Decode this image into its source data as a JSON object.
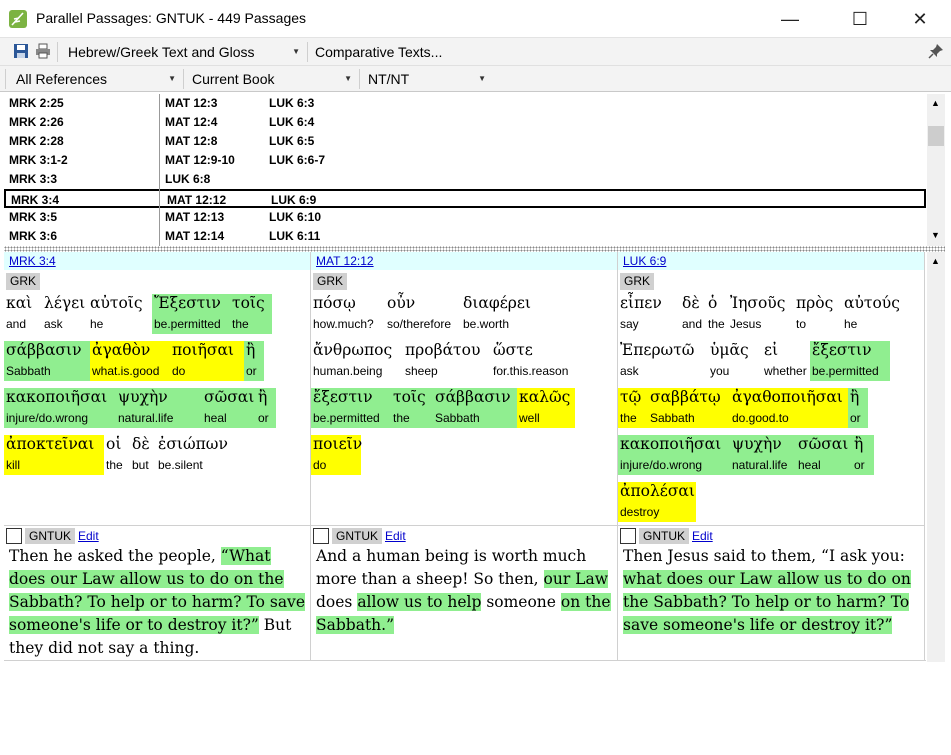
{
  "window": {
    "title": "Parallel Passages: GNTUK - 449 Passages",
    "minimize": "—",
    "maximize": "☐",
    "close": "✕"
  },
  "toolbar": {
    "text_combo": "Hebrew/Greek Text and Gloss",
    "comparative": "Comparative Texts...",
    "pin_icon": "pin-icon"
  },
  "filters": {
    "references": "All References",
    "book": "Current Book",
    "testament": "NT/NT"
  },
  "references": [
    {
      "c1": "MRK 2:25",
      "c2": "MAT 12:3",
      "c3": "LUK 6:3"
    },
    {
      "c1": "MRK 2:26",
      "c2": "MAT 12:4",
      "c3": "LUK 6:4"
    },
    {
      "c1": "MRK 2:28",
      "c2": "MAT 12:8",
      "c3": "LUK 6:5"
    },
    {
      "c1": "MRK 3:1-2",
      "c2": "MAT 12:9-10",
      "c3": "LUK 6:6-7"
    },
    {
      "c1": "MRK 3:3",
      "c2": "LUK 6:8",
      "c3": ""
    },
    {
      "c1": "MRK 3:4",
      "c2": "MAT 12:12",
      "c3": "LUK 6:9"
    },
    {
      "c1": "MRK 3:5",
      "c2": "MAT 12:13",
      "c3": "LUK 6:10"
    },
    {
      "c1": "MRK 3:6",
      "c2": "MAT 12:14",
      "c3": "LUK 6:11"
    }
  ],
  "selected_row": 5,
  "panes": [
    {
      "ref": "MRK 3:4",
      "badge": "GRK",
      "trans_badge": "GNTUK",
      "edit": "Edit",
      "words": [
        {
          "g": "καὶ",
          "e": "and"
        },
        {
          "g": "λέγει",
          "e": "ask"
        },
        {
          "g": "αὐτοῖς",
          "e": "he"
        },
        {
          "g": "Ἔξεστιν",
          "e": "be.permitted"
        },
        {
          "g": "τοῖς",
          "e": "the"
        },
        {
          "g": "σάββασιν",
          "e": "Sabbath"
        },
        {
          "g": "ἀγαθὸν",
          "e": "what.is.good"
        },
        {
          "g": "ποιῆσαι",
          "e": "do"
        },
        {
          "g": "ἢ",
          "e": "or"
        },
        {
          "g": "κακοποιῆσαι",
          "e": "injure/do.wrong"
        },
        {
          "g": "ψυχὴν",
          "e": "natural.life"
        },
        {
          "g": "σῶσαι",
          "e": "heal"
        },
        {
          "g": "ἢ",
          "e": "or"
        },
        {
          "g": "ἀποκτεῖναι",
          "e": "kill"
        },
        {
          "g": "οἱ",
          "e": "the"
        },
        {
          "g": "δὲ",
          "e": "but"
        },
        {
          "g": "ἐσιώπων",
          "e": "be.silent"
        }
      ],
      "text": [
        {
          "t": "Then he asked the people, ",
          "h": false
        },
        {
          "t": "“What does our Law allow us to do on the Sabbath? To help or to harm? To save someone's life or to destroy it?”",
          "h": true
        },
        {
          "t": " But they did not say a thing.",
          "h": false
        }
      ]
    },
    {
      "ref": "MAT 12:12",
      "badge": "GRK",
      "trans_badge": "GNTUK",
      "edit": "Edit",
      "words": [
        {
          "g": "πόσῳ",
          "e": "how.much?"
        },
        {
          "g": "οὖν",
          "e": "so/therefore"
        },
        {
          "g": "διαφέρει",
          "e": "be.worth"
        },
        {
          "g": "ἄνθρωπος",
          "e": "human.being"
        },
        {
          "g": "προβάτου",
          "e": "sheep"
        },
        {
          "g": "ὥστε",
          "e": "for.this.reason"
        },
        {
          "g": "ἔξεστιν",
          "e": "be.permitted"
        },
        {
          "g": "τοῖς",
          "e": "the"
        },
        {
          "g": "σάββασιν",
          "e": "Sabbath"
        },
        {
          "g": "καλῶς",
          "e": "well"
        },
        {
          "g": "ποιεῖν",
          "e": "do"
        }
      ],
      "text": [
        {
          "t": "And a human being is worth much more than a sheep! So then, ",
          "h": false
        },
        {
          "t": "our Law",
          "h": true
        },
        {
          "t": " does ",
          "h": false
        },
        {
          "t": "allow us to help",
          "h": true
        },
        {
          "t": " someone ",
          "h": false
        },
        {
          "t": "on the Sabbath.”",
          "h": true
        }
      ]
    },
    {
      "ref": "LUK 6:9",
      "badge": "GRK",
      "trans_badge": "GNTUK",
      "edit": "Edit",
      "words": [
        {
          "g": "εἶπεν",
          "e": "say"
        },
        {
          "g": "δὲ",
          "e": "and"
        },
        {
          "g": "ὁ",
          "e": "the"
        },
        {
          "g": "Ἰησοῦς",
          "e": "Jesus"
        },
        {
          "g": "πρὸς",
          "e": "to"
        },
        {
          "g": "αὐτούς",
          "e": "he"
        },
        {
          "g": "Ἐπερωτῶ",
          "e": "ask"
        },
        {
          "g": "ὑμᾶς",
          "e": "you"
        },
        {
          "g": "εἰ",
          "e": "whether"
        },
        {
          "g": "ἔξεστιν",
          "e": "be.permitted"
        },
        {
          "g": "τῷ",
          "e": "the"
        },
        {
          "g": "σαββάτῳ",
          "e": "Sabbath"
        },
        {
          "g": "ἀγαθοποιῆσαι",
          "e": "do.good.to"
        },
        {
          "g": "ἢ",
          "e": "or"
        },
        {
          "g": "κακοποιῆσαι",
          "e": "injure/do.wrong"
        },
        {
          "g": "ψυχὴν",
          "e": "natural.life"
        },
        {
          "g": "σῶσαι",
          "e": "heal"
        },
        {
          "g": "ἢ",
          "e": "or"
        },
        {
          "g": "ἀπολέσαι",
          "e": "destroy"
        }
      ],
      "text": [
        {
          "t": "Then Jesus said to them, “I ask you: ",
          "h": false
        },
        {
          "t": "what does our Law allow us to do on the Sabbath? To help or to harm? To save someone's life or destroy it?”",
          "h": true
        }
      ]
    }
  ],
  "colors": {
    "green": "#90ee90",
    "yellow": "#ffff00",
    "header": "#e0ffff"
  }
}
